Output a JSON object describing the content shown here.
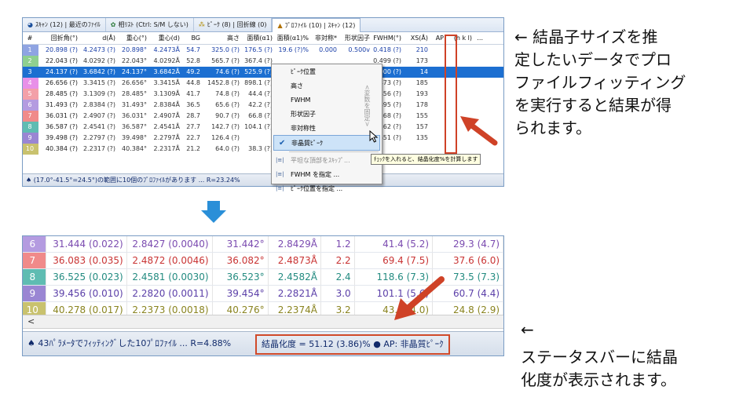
{
  "top": {
    "tabs": [
      {
        "label": "ｽｷｬﾝ (12) | 最近のﾌｧｲﾙ",
        "icon": "disc-icon"
      },
      {
        "label": "相ﾘｽﾄ (Ctrl: S/M しない)",
        "icon": "phase-icon"
      },
      {
        "label": "ﾋﾟｰｸ (8) | 回折線 (0)",
        "icon": "peak-icon"
      },
      {
        "label": "ﾌﾟﾛﾌｧｲﾙ (10) | ｽｷｬﾝ (12)",
        "icon": "profile-icon"
      }
    ],
    "columns": [
      "#",
      "回折角(°)",
      "d(Å)",
      "重心(°)",
      "重心(d)",
      "BG",
      "高さ",
      "面積(α1)",
      "面積(α1)%",
      "非対称*",
      "形状因子",
      "FWHM(°)",
      "XS(Å)",
      "AP",
      "(h k l)",
      "..."
    ],
    "rows": [
      {
        "n": "1",
        "c": [
          "20.898 (?)",
          "4.2473 (?)",
          "20.898°",
          "4.2473Å",
          "54.7",
          "325.0 (?)",
          "176.5 (?)",
          "19.6 (?)%",
          "0.000",
          "0.500v",
          "0.418 (?)",
          "210"
        ]
      },
      {
        "n": "2",
        "c": [
          "22.043 (?)",
          "4.0292 (?)",
          "22.043°",
          "4.0292Å",
          "52.8",
          "565.7 (?)",
          "367.4 (?)",
          "",
          "",
          "",
          "0.499 (?)",
          "173"
        ]
      },
      {
        "n": "3",
        "c": [
          "24.137 (?)",
          "3.6842 (?)",
          "24.137°",
          "3.6842Å",
          "49.2",
          "74.6 (?)",
          "525.9 (?)",
          "",
          "",
          "",
          "6.000 (?)",
          "14"
        ]
      },
      {
        "n": "4",
        "c": [
          "26.656 (?)",
          "3.3415 (?)",
          "26.656°",
          "3.3415Å",
          "44.8",
          "1452.8 (?)",
          "898.1 (?)",
          "",
          "",
          "",
          "0.473 (?)",
          "185"
        ]
      },
      {
        "n": "5",
        "c": [
          "28.485 (?)",
          "3.1309 (?)",
          "28.485°",
          "3.1309Å",
          "41.7",
          "74.8 (?)",
          "44.4 (?)",
          "",
          "",
          "",
          "0.456 (?)",
          "193"
        ]
      },
      {
        "n": "6",
        "c": [
          "31.493 (?)",
          "2.8384 (?)",
          "31.493°",
          "2.8384Å",
          "36.5",
          "65.6 (?)",
          "42.2 (?)",
          "",
          "",
          "",
          "0.495 (?)",
          "178"
        ]
      },
      {
        "n": "7",
        "c": [
          "36.031 (?)",
          "2.4907 (?)",
          "36.031°",
          "2.4907Å",
          "28.7",
          "90.7 (?)",
          "66.8 (?)",
          "",
          "",
          "",
          "0.568 (?)",
          "155"
        ]
      },
      {
        "n": "8",
        "c": [
          "36.587 (?)",
          "2.4541 (?)",
          "36.587°",
          "2.4541Å",
          "27.7",
          "142.7 (?)",
          "104.1 (?)",
          "",
          "",
          "",
          "0.562 (?)",
          "157"
        ]
      },
      {
        "n": "9",
        "c": [
          "39.498 (?)",
          "2.2797 (?)",
          "39.498°",
          "2.2797Å",
          "22.7",
          "126.4 (?)",
          "",
          "",
          "",
          "",
          "0.651 (?)",
          "135"
        ]
      },
      {
        "n": "10",
        "c": [
          "40.384 (?)",
          "2.2317 (?)",
          "40.384°",
          "2.2317Å",
          "21.2",
          "64.0 (?)",
          "38.3 (?)",
          "",
          "",
          "",
          "",
          ""
        ]
      }
    ],
    "status": "♠ (17.0°-41.5°=24.5°)の範囲に10個のﾌﾟﾛﾌｧｲﾙがあります ... R=23.24%",
    "menu": {
      "items": [
        "ﾋﾟｰｸ位置",
        "高さ",
        "FWHM",
        "形状因子",
        "非対称性",
        "非晶質ﾋﾟｰｸ",
        "平坦な頂部をｽｷｯﾌﾟ...",
        "FWHM を指定 ...",
        "ﾋﾟｰｸ位置を指定 ..."
      ],
      "vertical": "<変数を固定>",
      "tooltip": "ﾁｪｯｸを入れると、結晶化度%を計算します"
    }
  },
  "bottom": {
    "rows": [
      {
        "n": "6",
        "c": [
          "31.444 (0.022)",
          "2.8427 (0.0040)",
          "31.442°",
          "2.8429Å",
          "1.2",
          "41.4 (5.2)",
          "29.3 (4.7)"
        ]
      },
      {
        "n": "7",
        "c": [
          "36.083 (0.035)",
          "2.4872 (0.0046)",
          "36.082°",
          "2.4873Å",
          "2.2",
          "69.4 (7.5)",
          "37.6 (6.0)"
        ]
      },
      {
        "n": "8",
        "c": [
          "36.525 (0.023)",
          "2.4581 (0.0030)",
          "36.523°",
          "2.4582Å",
          "2.4",
          "118.6 (7.3)",
          "73.5 (7.3)"
        ]
      },
      {
        "n": "9",
        "c": [
          "39.456 (0.010)",
          "2.2820 (0.0011)",
          "39.454°",
          "2.2821Å",
          "3.0",
          "101.1 (5.6)",
          "60.7 (4.4)"
        ]
      },
      {
        "n": "10",
        "c": [
          "40.278 (0.017)",
          "2.2373 (0.0018)",
          "40.276°",
          "2.2374Å",
          "3.2",
          "43.5 (4.0)",
          "24.8 (2.9)"
        ]
      }
    ],
    "scroll_left": "<",
    "status_left": "♠ 43ﾊﾟﾗﾒｰﾀでﾌｨｯﾃｨﾝｸﾞした10ﾌﾟﾛﾌｧｲﾙ ... R=4.88%",
    "status_right": "結晶化度 = 51.12 (3.86)% ● AP: 非晶質ﾋﾟｰｸ"
  },
  "captions": {
    "top": [
      "← 結晶子サイズを推",
      "定したいデータでプロ",
      "ファイルフィッティング",
      "を実行すると結果が得",
      "られます。"
    ],
    "bottom_arrow": "←",
    "bottom": [
      "ステータスバーに結晶",
      "化度が表示されます。"
    ]
  },
  "colors": {
    "row_colors": [
      "#8fa4e2",
      "#8fd08f",
      "#1c6fd1",
      "#e890e8",
      "#f3a0a8",
      "#b49be0",
      "#f08a8a",
      "#5fbcb2",
      "#9a86d3",
      "#c9c26e"
    ],
    "bottom_row_colors": [
      "#b49be0",
      "#f08a8a",
      "#5fbcb2",
      "#9a86d3",
      "#c9c26e"
    ],
    "accent_red": "#cf4227",
    "arrow_blue": "#2a8fd8"
  }
}
